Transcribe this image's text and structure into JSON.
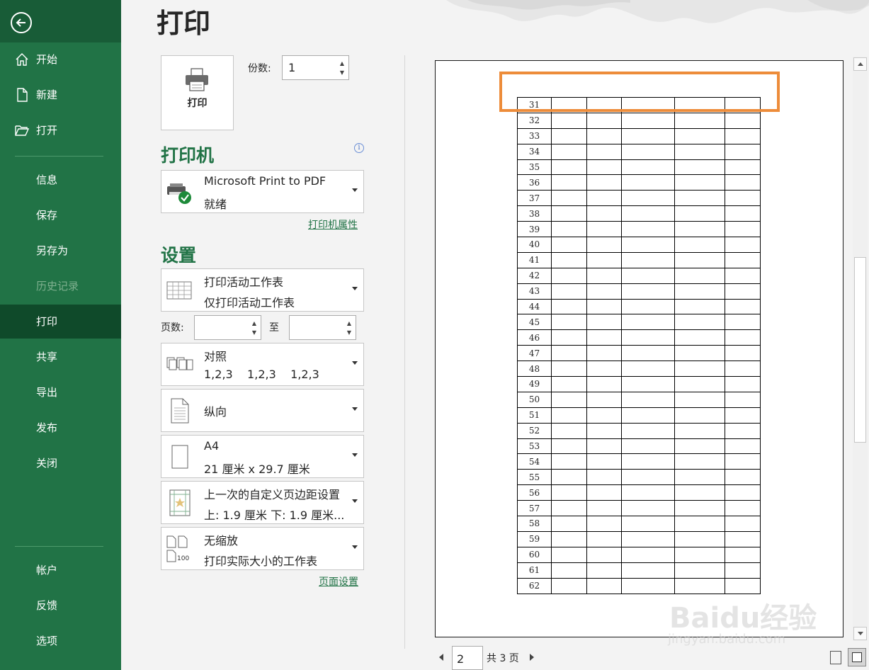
{
  "sidebar": {
    "items": [
      {
        "label": "开始"
      },
      {
        "label": "新建"
      },
      {
        "label": "打开"
      },
      {
        "label": "信息"
      },
      {
        "label": "保存"
      },
      {
        "label": "另存为"
      },
      {
        "label": "历史记录"
      },
      {
        "label": "打印"
      },
      {
        "label": "共享"
      },
      {
        "label": "导出"
      },
      {
        "label": "发布"
      },
      {
        "label": "关闭"
      },
      {
        "label": "帐户"
      },
      {
        "label": "反馈"
      },
      {
        "label": "选项"
      }
    ],
    "active_item": "打印",
    "disabled_item": "历史记录"
  },
  "page_title": "打印",
  "print_button_label": "打印",
  "copies": {
    "label": "份数:",
    "value": "1"
  },
  "printer": {
    "heading": "打印机",
    "name": "Microsoft Print to PDF",
    "status": "就绪",
    "properties_link": "打印机属性"
  },
  "settings": {
    "heading": "设置",
    "what_to_print": {
      "title": "打印活动工作表",
      "subtitle": "仅打印活动工作表"
    },
    "pages": {
      "label": "页数:",
      "to_label": "至",
      "from_value": "",
      "to_value": ""
    },
    "collation": {
      "title": "对照",
      "subtitle": "1,2,3    1,2,3    1,2,3"
    },
    "orientation": {
      "title": "纵向"
    },
    "paper_size": {
      "title": "A4",
      "subtitle": "21 厘米 x 29.7 厘米"
    },
    "margins": {
      "title": "上一次的自定义页边距设置",
      "subtitle": "上: 1.9 厘米 下: 1.9 厘米..."
    },
    "scaling": {
      "title": "无缩放",
      "subtitle": "打印实际大小的工作表"
    },
    "page_setup_link": "页面设置"
  },
  "preview": {
    "row_numbers": [
      "31",
      "32",
      "33",
      "34",
      "35",
      "36",
      "37",
      "38",
      "39",
      "40",
      "41",
      "42",
      "43",
      "44",
      "45",
      "46",
      "47",
      "48",
      "49",
      "50",
      "51",
      "52",
      "53",
      "54",
      "55",
      "56",
      "57",
      "58",
      "59",
      "60",
      "61",
      "62"
    ],
    "current_page": "2",
    "total_pages_text": "共 3 页"
  },
  "watermark": {
    "main": "Baidu经验",
    "sub": "jingyan.baidu.com"
  },
  "colors": {
    "sidebar": "#217346",
    "sidebar_active": "#0f4a2a",
    "accent": "#217346",
    "highlight": "#ed8c3a"
  }
}
